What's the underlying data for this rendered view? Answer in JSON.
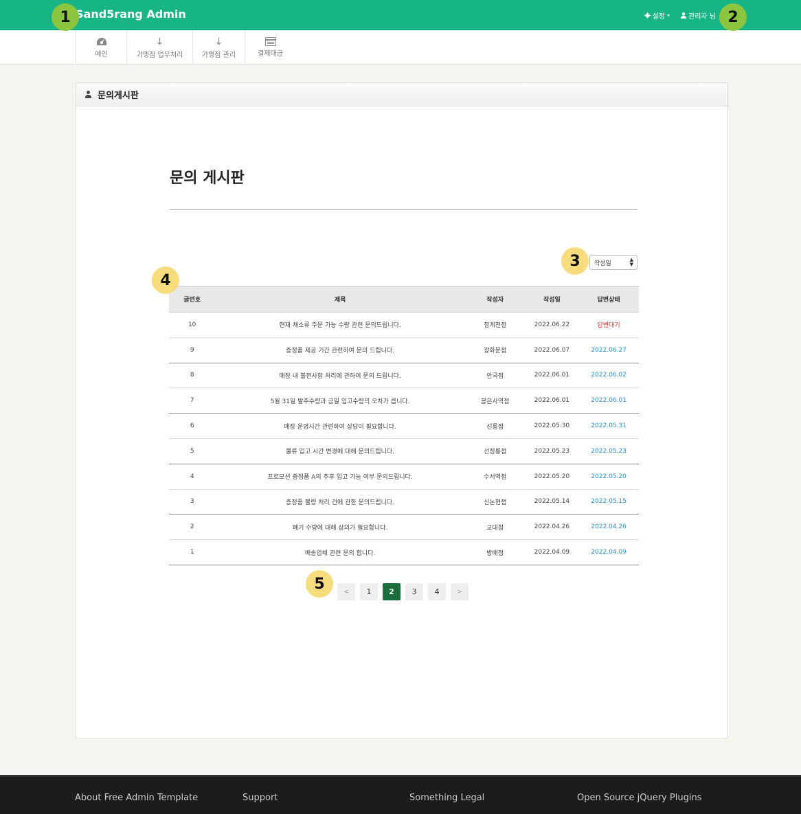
{
  "header": {
    "brand": "Sand5rang Admin",
    "settings_label": "설정",
    "user_label": "관리자 님"
  },
  "nav": {
    "items": [
      {
        "icon": "dashboard-icon",
        "label": "메인"
      },
      {
        "icon": "arrow-down-icon",
        "label": "가맹점 업무처리"
      },
      {
        "icon": "arrow-down-icon",
        "label": "가맹점 관리"
      },
      {
        "icon": "card-icon",
        "label": "결제대금"
      }
    ]
  },
  "panel": {
    "heading": "문의게시판",
    "board_title": "문의 게시판",
    "sort": {
      "selected": "작성일"
    }
  },
  "table": {
    "headers": [
      "글번호",
      "제목",
      "작성자",
      "작성일",
      "답변상태"
    ],
    "rows": [
      {
        "no": "10",
        "title": "현재 채소류 주문 가능 수량 관련 문의드립니다.",
        "author": "청계천점",
        "date": "2022.06.22",
        "status": "답변대기",
        "pending": true
      },
      {
        "no": "9",
        "title": "증정품 제공 기간 관련하여 문의 드립니다.",
        "author": "광화문점",
        "date": "2022.06.07",
        "status": "2022.06.27",
        "pending": false
      },
      {
        "no": "8",
        "title": "매장 내 불편사항 처리에 관하여 문의 드립니다.",
        "author": "안국점",
        "date": "2022.06.01",
        "status": "2022.06.02",
        "pending": false
      },
      {
        "no": "7",
        "title": "5월 31일 발주수량과 금일 입고수량의 오차가 큽니다.",
        "author": "봉은사역점",
        "date": "2022.06.01",
        "status": "2022.06.01",
        "pending": false
      },
      {
        "no": "6",
        "title": "매장 운영시간 관련하여 상담이 필요합니다.",
        "author": "선릉점",
        "date": "2022.05.30",
        "status": "2022.05.31",
        "pending": false
      },
      {
        "no": "5",
        "title": "물류 입고 시간 변경에 대해 문의드립니다.",
        "author": "선정릉점",
        "date": "2022.05.23",
        "status": "2022.05.23",
        "pending": false
      },
      {
        "no": "4",
        "title": "프로모션 증정품 A의 추후 입고 가능 여부 문의드립니다.",
        "author": "수서역점",
        "date": "2022.05.20",
        "status": "2022.05.20",
        "pending": false
      },
      {
        "no": "3",
        "title": "증정품 불량 처리 건에 관한 문의드립니다.",
        "author": "신논현점",
        "date": "2022.05.14",
        "status": "2022.05.15",
        "pending": false
      },
      {
        "no": "2",
        "title": "폐기 수량에 대해 상의가 필요합니다.",
        "author": "교대점",
        "date": "2022.04.26",
        "status": "2022.04.26",
        "pending": false
      },
      {
        "no": "1",
        "title": "배송업체 관련 문의 합니다.",
        "author": "방배점",
        "date": "2022.04.09",
        "status": "2022.04.09",
        "pending": false
      }
    ]
  },
  "pagination": {
    "prev": "<",
    "next": ">",
    "pages": [
      "1",
      "2",
      "3",
      "4"
    ],
    "current": "2"
  },
  "footer": {
    "links": [
      "About Free Admin Template",
      "Support",
      "Something Legal",
      "Open Source jQuery Plugins"
    ]
  },
  "markers": [
    "1",
    "2",
    "3",
    "4",
    "5"
  ],
  "colors": {
    "topbar": "#17b485",
    "active_page": "#1c6e3d",
    "pending_status": "#d9342b",
    "answered_status": "#2a8fd0"
  }
}
